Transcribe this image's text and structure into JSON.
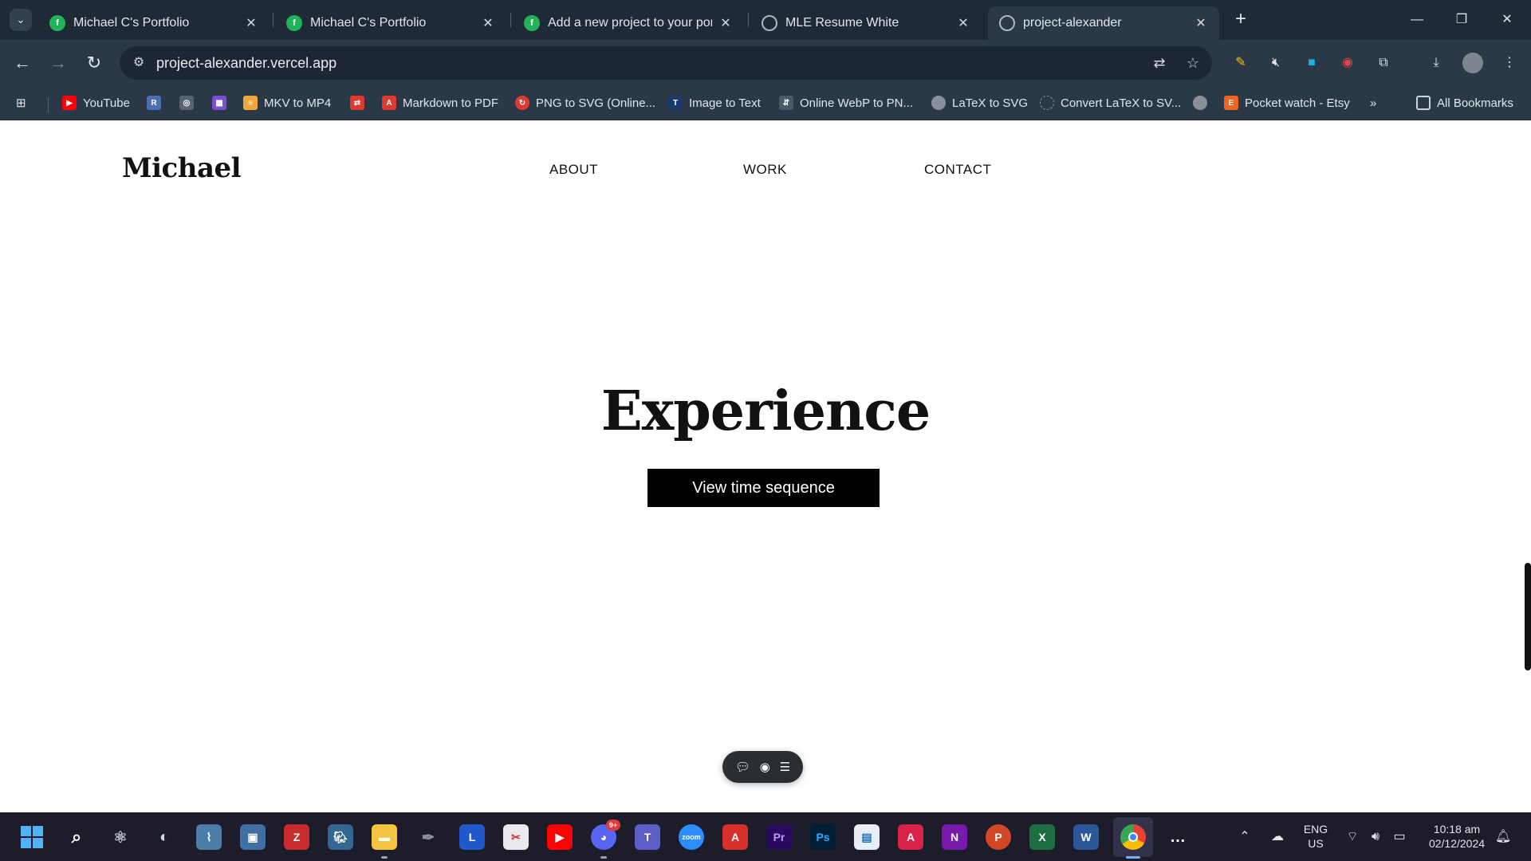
{
  "tabs": [
    {
      "title": "Michael C's Portfolio",
      "icon": "framer-icon"
    },
    {
      "title": "Michael C's Portfolio",
      "icon": "framer-icon"
    },
    {
      "title": "Add a new project to your portf",
      "icon": "framer-icon"
    },
    {
      "title": "MLE Resume White",
      "icon": "globe-icon"
    },
    {
      "title": "project-alexander",
      "icon": "globe-icon",
      "active": true
    }
  ],
  "address_bar": {
    "url": "project-alexander.vercel.app"
  },
  "bookmarks": [
    {
      "label": "YouTube",
      "color": "#ff0000"
    },
    {
      "label": "MKV to MP4",
      "color": "#f2a73b"
    },
    {
      "label": "Markdown to PDF",
      "color": "#e03a2f"
    },
    {
      "label": "PNG to SVG (Online...",
      "color": "#e03a2f"
    },
    {
      "label": "Image to Text",
      "color": "#1a3a6b"
    },
    {
      "label": "Online WebP to PN...",
      "color": "#4a5a6b"
    },
    {
      "label": "LaTeX to SVG",
      "color": "#8a9099"
    },
    {
      "label": "Convert LaTeX to SV...",
      "color": "#8a9099"
    },
    {
      "label": "Pocket watch - Etsy",
      "color": "#f1641e"
    },
    {
      "label": "All Bookmarks",
      "color": "#8a9099"
    }
  ],
  "site": {
    "logo": "Michael",
    "nav": [
      "ABOUT",
      "WORK",
      "CONTACT"
    ],
    "hero_title": "Experience",
    "cta_label": "View time sequence"
  },
  "taskbar": {
    "language": "ENG",
    "region": "US",
    "time": "10:18 am",
    "date": "02/12/2024",
    "discord_badge": "9+"
  },
  "colors": {
    "chrome_dark": "#1f2a37",
    "chrome_mid": "#2b3847",
    "accent_green": "#22b35a",
    "button_black": "#000000"
  }
}
